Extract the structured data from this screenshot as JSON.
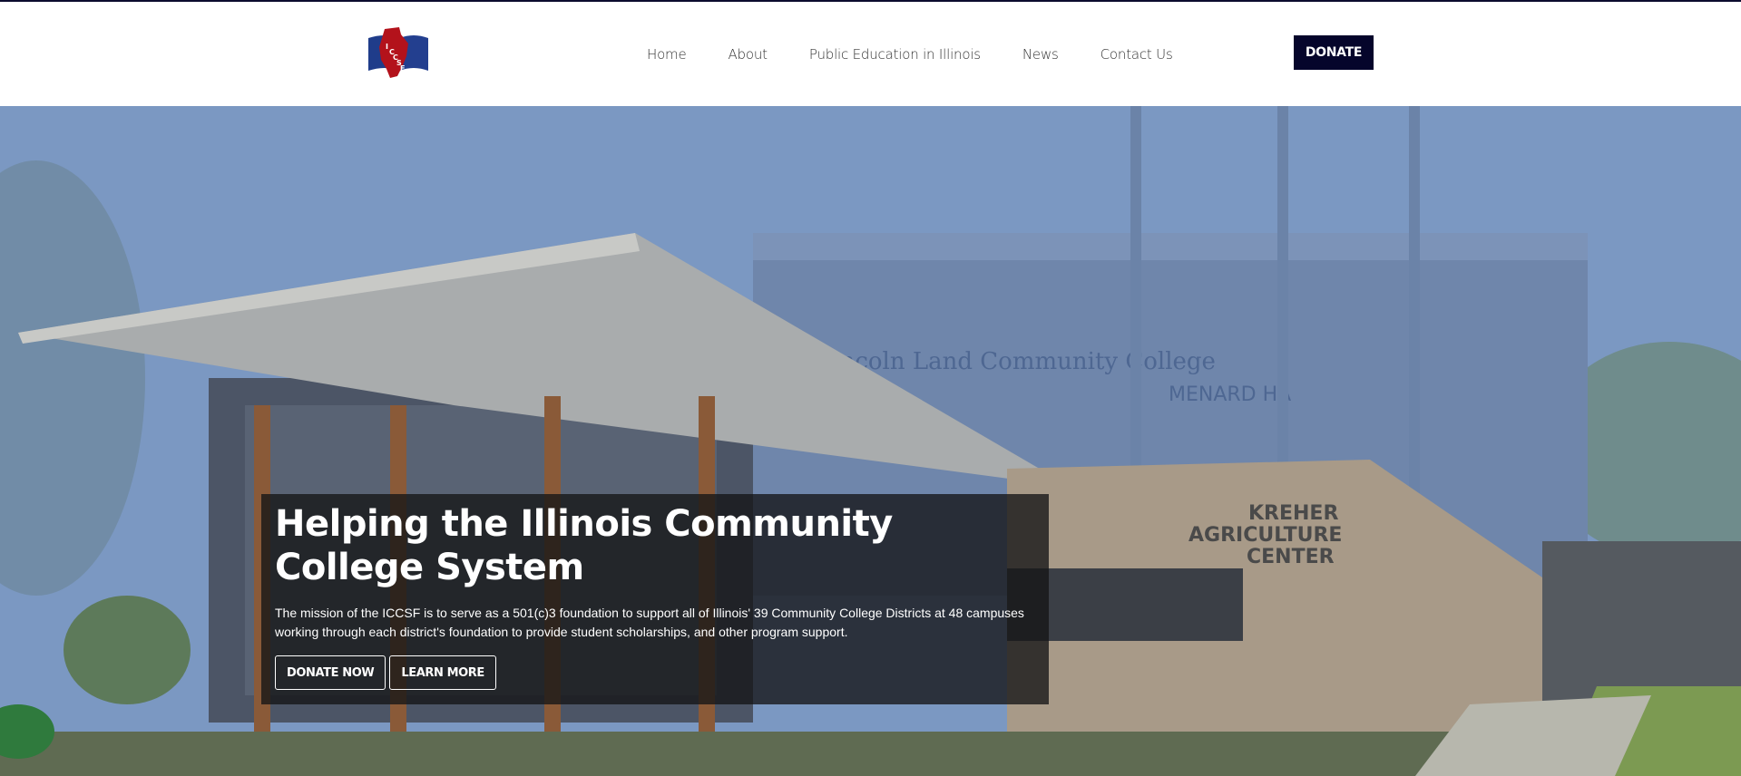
{
  "header": {
    "logo_alt": "ICCSF logo",
    "logo_letters": [
      "I",
      "C",
      "C",
      "S",
      "F"
    ],
    "nav": [
      {
        "label": "Home"
      },
      {
        "label": "About"
      },
      {
        "label": "Public Education in Illinois"
      },
      {
        "label": "News"
      },
      {
        "label": "Contact Us"
      }
    ],
    "donate_label": "DONATE"
  },
  "hero": {
    "building_sign_college": "Lincoln Land Community College",
    "building_sign_hall": "MENARD HA",
    "building_sign_center": [
      "KREHER",
      "AGRICULTURE",
      "CENTER"
    ],
    "title": "Helping the Illinois Community College System",
    "text": "The mission of the ICCSF is to serve as a 501(c)3 foundation to support all of Illinois' 39 Community College Districts at 48 campuses working through each district's foundation to provide student scholarships, and other program support.",
    "donate_now_label": "DONATE NOW",
    "learn_more_label": "LEARN MORE"
  },
  "colors": {
    "brand_navy": "#05052b",
    "logo_red": "#b3121b",
    "logo_blue": "#1f3c8a",
    "text_dark": "#333333"
  }
}
